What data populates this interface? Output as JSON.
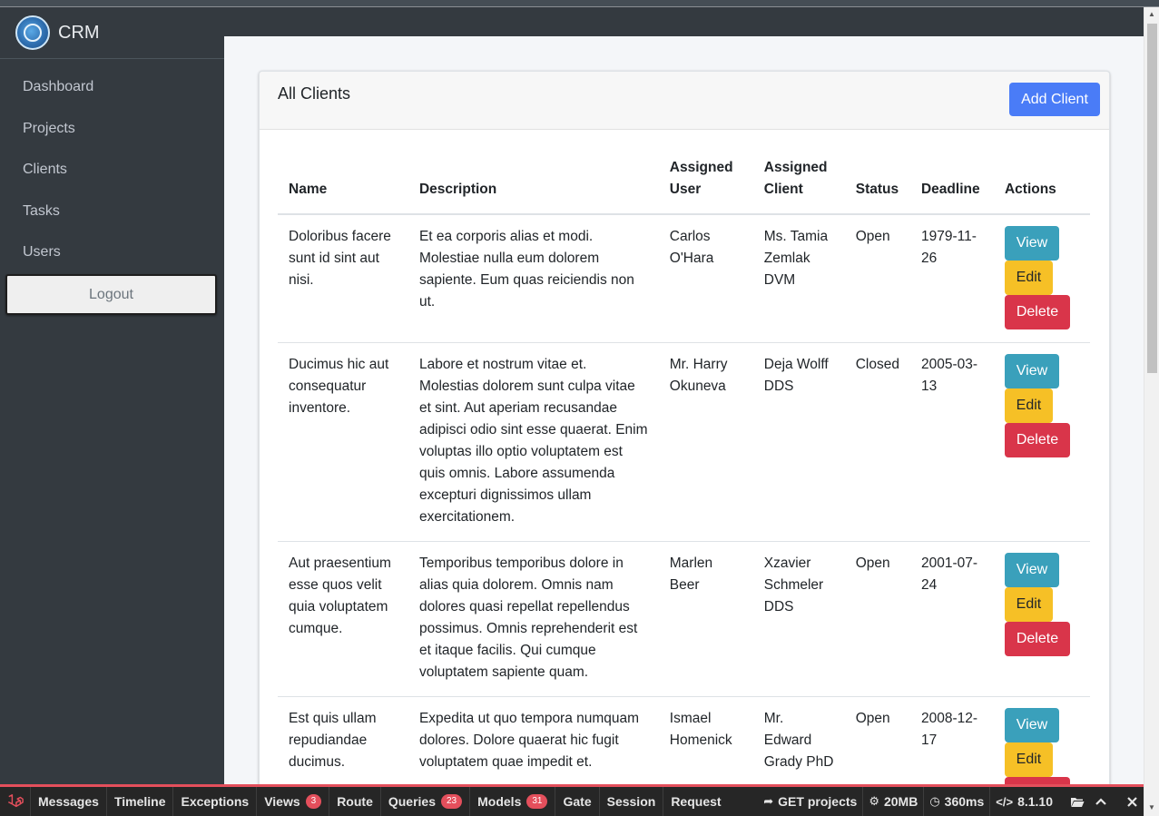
{
  "brand": {
    "name": "CRM"
  },
  "sidebar": {
    "items": [
      {
        "label": "Dashboard"
      },
      {
        "label": "Projects"
      },
      {
        "label": "Clients"
      },
      {
        "label": "Tasks"
      },
      {
        "label": "Users"
      }
    ],
    "logout_label": "Logout"
  },
  "card": {
    "title": "All Clients",
    "add_button": "Add Client"
  },
  "table": {
    "headers": {
      "name": "Name",
      "description": "Description",
      "assigned_user": "Assigned User",
      "assigned_client": "Assigned Client",
      "status": "Status",
      "deadline": "Deadline",
      "actions": "Actions"
    },
    "action_labels": {
      "view": "View",
      "edit": "Edit",
      "delete": "Delete"
    },
    "rows": [
      {
        "name": "Doloribus facere sunt id sint aut nisi.",
        "description": "Et ea corporis alias et modi. Molestiae nulla eum dolorem sapiente. Eum quas reiciendis non ut.",
        "assigned_user": "Carlos O'Hara",
        "assigned_client": "Ms. Tamia Zemlak DVM",
        "status": "Open",
        "deadline": "1979-11-26"
      },
      {
        "name": "Ducimus hic aut consequatur inventore.",
        "description": "Labore et nostrum vitae et. Molestias dolorem sunt culpa vitae et sint. Aut aperiam recusandae adipisci odio sint esse quaerat. Enim voluptas illo optio voluptatem est quis omnis. Labore assumenda excepturi dignissimos ullam exercitationem.",
        "assigned_user": "Mr. Harry Okuneva",
        "assigned_client": "Deja Wolff DDS",
        "status": "Closed",
        "deadline": "2005-03-13"
      },
      {
        "name": "Aut praesentium esse quos velit quia voluptatem cumque.",
        "description": "Temporibus temporibus dolore in alias quia dolorem. Omnis nam dolores quasi repellat repellendus possimus. Omnis reprehenderit est et itaque facilis. Qui cumque voluptatem sapiente quam.",
        "assigned_user": "Marlen Beer",
        "assigned_client": "Xzavier Schmeler DDS",
        "status": "Open",
        "deadline": "2001-07-24"
      },
      {
        "name": "Est quis ullam repudiandae ducimus.",
        "description": "Expedita ut quo tempora numquam dolores. Dolore quaerat hic fugit voluptatem quae impedit et.",
        "assigned_user": "Ismael Homenick",
        "assigned_client": "Mr. Edward Grady PhD",
        "status": "Open",
        "deadline": "2008-12-17"
      }
    ]
  },
  "debugbar": {
    "tabs": [
      {
        "label": "Messages"
      },
      {
        "label": "Timeline"
      },
      {
        "label": "Exceptions"
      },
      {
        "label": "Views",
        "badge": "3"
      },
      {
        "label": "Route"
      },
      {
        "label": "Queries",
        "badge": "23"
      },
      {
        "label": "Models",
        "badge": "31"
      },
      {
        "label": "Gate"
      },
      {
        "label": "Session"
      },
      {
        "label": "Request"
      }
    ],
    "route": "GET projects",
    "memory": "20MB",
    "time": "360ms",
    "php_version": "8.1.10",
    "accent_color": "#e44f5c"
  }
}
